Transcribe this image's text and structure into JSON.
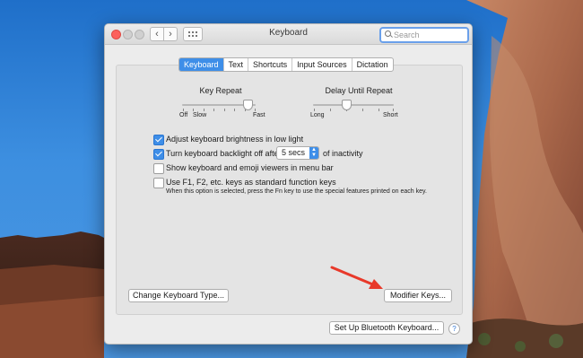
{
  "window": {
    "title": "Keyboard",
    "search_placeholder": "Search",
    "nav_back": "‹",
    "nav_forward": "›"
  },
  "tabs": [
    {
      "label": "Keyboard",
      "active": true
    },
    {
      "label": "Text",
      "active": false
    },
    {
      "label": "Shortcuts",
      "active": false
    },
    {
      "label": "Input Sources",
      "active": false
    },
    {
      "label": "Dictation",
      "active": false
    }
  ],
  "key_repeat": {
    "title": "Key Repeat",
    "left_label_1": "Off",
    "left_label_2": "Slow",
    "right_label": "Fast"
  },
  "delay_repeat": {
    "title": "Delay Until Repeat",
    "left_label": "Long",
    "right_label": "Short"
  },
  "options": [
    {
      "label": "Adjust keyboard brightness in low light",
      "checked": true
    },
    {
      "label": "Turn keyboard backlight off after",
      "checked": true
    },
    {
      "label": "Show keyboard and emoji viewers in menu bar",
      "checked": false
    },
    {
      "label": "Use F1, F2, etc. keys as standard function keys",
      "checked": false
    }
  ],
  "backlight": {
    "value": "5 secs",
    "suffix": "of inactivity"
  },
  "fn_note": "When this option is selected, press the Fn key to use the special features printed on each key.",
  "buttons": {
    "change_type": "Change Keyboard Type...",
    "modifier_keys": "Modifier Keys...",
    "bluetooth": "Set Up Bluetooth Keyboard...",
    "help": "?"
  },
  "colors": {
    "accent": "#3e8ee8",
    "close_light": "#fc605c",
    "annotation_arrow": "#e8392a"
  }
}
